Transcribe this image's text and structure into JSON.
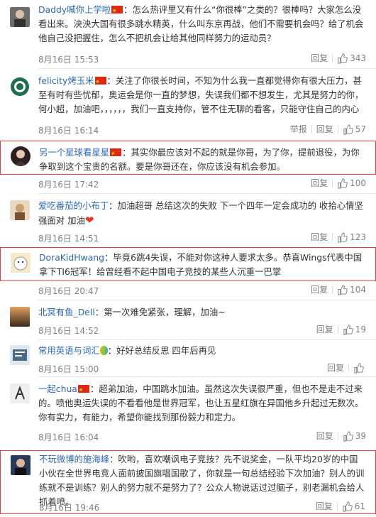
{
  "report_label": "举报",
  "reply_label": "回复",
  "comments": [
    {
      "user": "Daddy喊你上学啦",
      "text": "：怎么热评里又有什么“你很棒”之类的？很棒吗？大家怎么没看出来。泱泱大国有很多跳水精英，什么叫东京再战，他们不需要机会吗？给了机会他自己没把握住，怎么不把机会让给其他同样努力的运动员？",
      "time": "8月16日 15:53",
      "likes": "343",
      "avatar_color": "#5a5a5a"
    },
    {
      "user": "felicity烤玉米",
      "text": "：关注了你很长时间，不知为什么我一直都觉得你有很大压力，甚至有时有些忧郁，奥运会是你一直的梦想，失误我们都不想发生，尤其是努力的你，何小超，加油吧，，，，，，我们一直支持你，管不住无聊的看客，只能守住自己的内心",
      "time": "8月16日 16:14",
      "likes": "57",
      "avatar_color": "#1e6e4e"
    },
    {
      "user": "另一个星球看星星",
      "text": "：其实你最应该对不起的就是你哥，为了你，提前退役，为你争取到这个宝贵的名额。要是你哥还在，你应该没有机会参加。",
      "time": "8月16日 17:42",
      "likes": "100",
      "avatar_color": "#3a2a2a"
    },
    {
      "user": "爱吃番茄的小布丁",
      "text": "：加油超哥 总结这次的失败 下一个四年一定会成功的 收拾心情坚强面对 加油",
      "time": "8月16日 14:51",
      "likes": "123",
      "avatar_color": "#c8a070"
    },
    {
      "user": "DoraKidHwang",
      "text": "：毕竟6跳4失误，不能对你这种人要求太多。恭喜Wings代表中国拿下TI6冠军！给曾经看不起中国电子竞技的某些人沉重一巴掌",
      "time": "8月16日 20:47",
      "likes": "104",
      "avatar_color": "#f4e9c8"
    },
    {
      "user": "北冥有鱼_Dell",
      "text": "：第一次难免紧张，理解，加油~",
      "time": "8月16日 14:52",
      "likes": "19",
      "avatar_color": "#6a4a2a"
    },
    {
      "user": "常用英语与词汇",
      "text": "：好好总结反思 四年后再见",
      "time": "8月16日 15:00",
      "likes": "",
      "avatar_color": "#4a6a8a"
    },
    {
      "user": "一起chua",
      "text": "：超弟加油，中国跳水加油。虽然这次失误很严重，但也不是走不过来的。喷他奥运失误的不看看他是世界冠军，也让五星红旗在异国他乡升起过无数次。你有实力，有能力，希望你能找到那份毅力和定力。",
      "time": "8月16日 16:04",
      "likes": "39",
      "avatar_color": "#bbbbbb"
    },
    {
      "user": "不玩微博的施海峰",
      "text": "：吹哟，喜欢嘲讽电子竞技？先不说奖金，一队平均20岁的中国小伙在全世界电竞人面前披国旗唱国歌了，你就是一句总结经验下次加油？别人的训练就不是训练？别人的努力就不是努力了？公众人物说话过过脑子，别老漏机会给人抓着喷。",
      "time": "8月16日 19:46",
      "likes": "61",
      "avatar_color": "#2a3a5a"
    }
  ]
}
